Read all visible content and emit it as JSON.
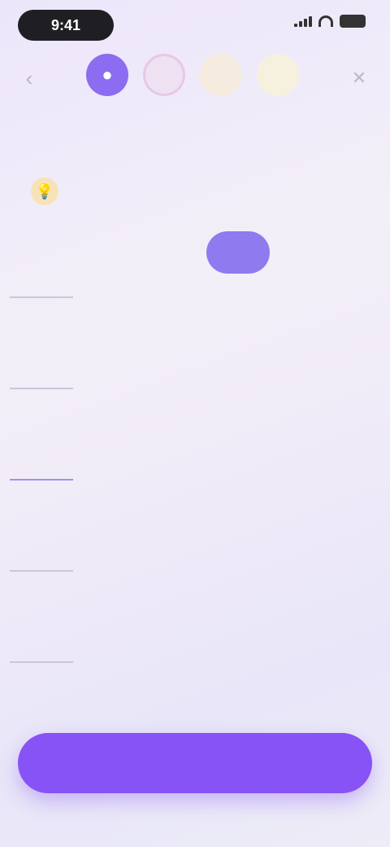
{
  "status_bar": {
    "time": "9:41",
    "signal_icon": "signal-icon",
    "wifi_icon": "wifi-icon",
    "battery_icon": "battery-icon"
  },
  "header": {
    "back_icon": "‹",
    "close_icon": "✕",
    "steps": [
      {
        "icon": "●",
        "state": "active"
      },
      {
        "icon": "",
        "state": "upcoming"
      },
      {
        "icon": "",
        "state": "upcoming"
      },
      {
        "icon": "",
        "state": "upcoming"
      }
    ]
  },
  "page": {
    "title": "",
    "hint": "",
    "hint_icon": "💡"
  },
  "unit_toggle": {
    "options": [
      "",
      ""
    ],
    "selected_index": 1
  },
  "ruler": {
    "labels": [
      "",
      "",
      "",
      "",
      ""
    ],
    "current_index": 2
  },
  "weight": {
    "value": "",
    "unit": ""
  },
  "cta": {
    "label": ""
  },
  "colors": {
    "accent": "#8753f4",
    "accent_soft": "#8f7af0",
    "hint_bg": "#f8e3b8"
  }
}
